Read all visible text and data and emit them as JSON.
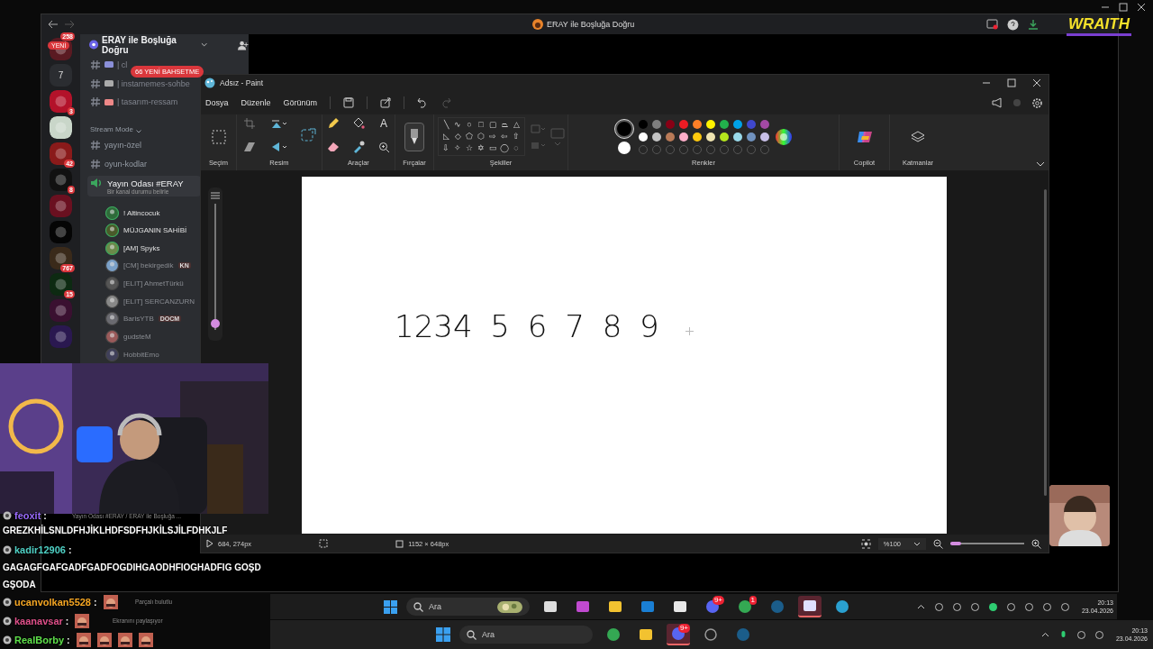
{
  "stream_window": {
    "title": "ERAY ile Boşluğa Doğru"
  },
  "overlay_logo": "WRAITH",
  "discord": {
    "server_name": "ERAY ile Boşluğa Doğru",
    "new_pill": "YENİ",
    "mentions_pill": "66 YENİ BAHSETME",
    "servers": [
      {
        "kind": "picture",
        "badge": "258"
      },
      {
        "kind": "folder",
        "label": "7"
      },
      {
        "kind": "picture",
        "badge": "3"
      },
      {
        "kind": "picture"
      },
      {
        "kind": "picture",
        "badge": "42"
      },
      {
        "kind": "picture",
        "badge": "8"
      },
      {
        "kind": "picture"
      },
      {
        "kind": "picture"
      },
      {
        "kind": "picture",
        "badge": "767"
      },
      {
        "kind": "picture",
        "badge": "15"
      },
      {
        "kind": "picture"
      },
      {
        "kind": "picture"
      }
    ],
    "channels": [
      {
        "name": "| cl",
        "kind": "text"
      },
      {
        "name": "| instamemes-sohbe",
        "kind": "text"
      },
      {
        "name": "| tasarım-ressam",
        "kind": "text"
      },
      {
        "name": "Stream Mode",
        "kind": "category"
      },
      {
        "name": "yayın-özel",
        "kind": "text"
      },
      {
        "name": "oyun-kodlar",
        "kind": "text"
      },
      {
        "name": "Yayın Odası #ERAY",
        "kind": "voice",
        "status": "Bir kanal durumu belirle"
      }
    ],
    "members": [
      {
        "name": "! Altincocuk",
        "dimmed": false
      },
      {
        "name": "MÜJGANIN SAHİBİ",
        "dimmed": false
      },
      {
        "name": "[AM] Spyks",
        "dimmed": false
      },
      {
        "name": "[CM] bekirgedik",
        "dimmed": true,
        "tag": "KN"
      },
      {
        "name": "[ELIT] AhmetTürkü",
        "dimmed": true
      },
      {
        "name": "[ELIT] SERCANZURN",
        "dimmed": true
      },
      {
        "name": "BarisYTB",
        "dimmed": true,
        "tag": "DOCM"
      },
      {
        "name": "gudsteM",
        "dimmed": true
      },
      {
        "name": "HobbitEmo",
        "dimmed": true
      }
    ],
    "call_title": "Yayın Odası #ERAY / ERAY ile Boşluğa ...",
    "screen_share": "Ekranını paylaşıyor",
    "weather": "Parçalı bulutlu"
  },
  "paint": {
    "title": "Adsız - Paint",
    "menus": [
      "Dosya",
      "Düzenle",
      "Görünüm"
    ],
    "groups": [
      "Seçim",
      "Resim",
      "Araçlar",
      "Fırçalar",
      "Şekiller",
      "Renkler",
      "Copilot",
      "Katmanlar"
    ],
    "text_tool": "A",
    "shapes": [
      "╲",
      "∿",
      "○",
      "□",
      "▢",
      "⏢",
      "△",
      "◺",
      "◇",
      "⬠",
      "⬡",
      "⇨",
      "⇦",
      "⇧",
      "⇩",
      "✧",
      "☆",
      "✡",
      "▭",
      "◯",
      "◌"
    ],
    "colors": [
      {
        "color": "#000000"
      },
      {
        "color": "#7f7f7f"
      },
      {
        "color": "#880015"
      },
      {
        "color": "#ed1c24"
      },
      {
        "color": "#ff7f27"
      },
      {
        "color": "#fff200"
      },
      {
        "color": "#22b14c"
      },
      {
        "color": "#00a2e8"
      },
      {
        "color": "#3f48cc"
      },
      {
        "color": "#a349a4"
      },
      {
        "color": "#ffffff"
      },
      {
        "color": "#c3c3c3"
      },
      {
        "color": "#b97a57"
      },
      {
        "color": "#ffaec9"
      },
      {
        "color": "#ffc90e"
      },
      {
        "color": "#efe4b0"
      },
      {
        "color": "#b5e61d"
      },
      {
        "color": "#99d9ea"
      },
      {
        "color": "#7092be"
      },
      {
        "color": "#c8bfe7"
      }
    ],
    "brush_size": {
      "level": 0.05
    },
    "canvas_text": "1234 5 6 7 8 9",
    "status": {
      "cursor": "684, 274px",
      "canvas_size": "1152 × 648px",
      "zoom": "%100",
      "zoom_slider": {
        "level": 0.15
      }
    }
  },
  "chat": [
    {
      "user": "feoxit",
      "separator": ":",
      "color": "#9b6bff"
    },
    {
      "text": "GREZKHİLSNLDFHJİKLHDFSDFHJKİLSJİLFDHKJLF"
    },
    {
      "user": "kadir12906",
      "separator": ":",
      "color": "#4fd1c5"
    },
    {
      "text": "GAGAGFGAFGADFGADFOGDIHGAODHFIOGHADFIG GOŞDGŞODA"
    },
    {
      "user": "ucanvolkan5528",
      "separator": ":",
      "color": "#f5a623",
      "emotes": [
        {
          "kind": "picture"
        }
      ]
    },
    {
      "user": "kaanavsar",
      "separator": ":",
      "color": "#e0508a",
      "emotes": [
        {
          "kind": "picture"
        }
      ]
    },
    {
      "user": "RealBorby",
      "separator": ":",
      "color": "#5ee04a",
      "emotes": [
        {
          "kind": "picture"
        },
        {
          "kind": "picture"
        },
        {
          "kind": "picture"
        },
        {
          "kind": "picture"
        }
      ]
    }
  ],
  "inner_taskbar": {
    "search": "Ara",
    "time": "20:13",
    "date": "23.04.2026",
    "apps": [
      {
        "kind": "taskview",
        "active": false
      },
      {
        "kind": "office",
        "active": false
      },
      {
        "kind": "files",
        "active": false
      },
      {
        "kind": "mail",
        "active": false
      },
      {
        "kind": "store",
        "active": false
      },
      {
        "kind": "discord",
        "active": false,
        "badge": "9+"
      },
      {
        "kind": "chrome",
        "active": false,
        "badge": "1"
      },
      {
        "kind": "steam",
        "active": false
      },
      {
        "kind": "ea",
        "active": true
      },
      {
        "kind": "globe",
        "active": false
      }
    ]
  },
  "outer_taskbar": {
    "search": "Ara",
    "time": "20:13",
    "date": "23.04.2026",
    "apps": [
      {
        "kind": "chrome",
        "active": false
      },
      {
        "kind": "files",
        "active": false
      },
      {
        "kind": "discord",
        "active": true,
        "badge": "9+"
      },
      {
        "kind": "clock",
        "active": false
      },
      {
        "kind": "steam",
        "active": false
      }
    ]
  }
}
